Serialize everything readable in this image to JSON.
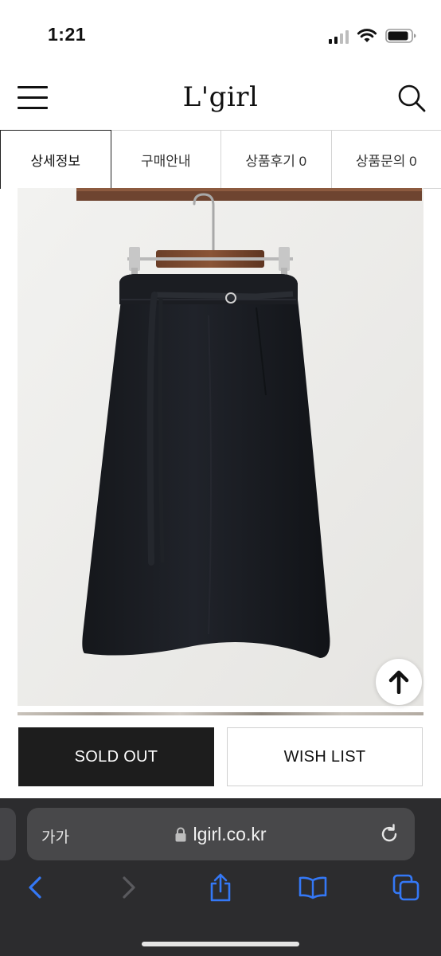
{
  "status_bar": {
    "time": "1:21",
    "icons": [
      "signal-icon",
      "wifi-icon",
      "battery-icon"
    ]
  },
  "header": {
    "logo": "L'girl",
    "menu_icon": "menu-icon",
    "search_icon": "search-icon"
  },
  "tabs": [
    {
      "label": "상세정보",
      "active": true
    },
    {
      "label": "구매안내",
      "active": false
    },
    {
      "label": "상품후기 0",
      "active": false
    },
    {
      "label": "상품문의 0",
      "active": false
    }
  ],
  "product": {
    "image": "black-skirt-on-hanger",
    "scroll_top_icon": "arrow-up-icon"
  },
  "buttons": {
    "sold_out": "SOLD OUT",
    "wish_list": "WISH LIST"
  },
  "browser": {
    "text_size_label": "가가",
    "url": "lgirl.co.kr",
    "secure_icon": "lock-icon",
    "reload_icon": "reload-icon",
    "toolbar": [
      "back-icon",
      "forward-icon",
      "share-icon",
      "bookmarks-icon",
      "tabs-icon"
    ]
  },
  "colors": {
    "accent_dark": "#1d1d1d",
    "browser_bar": "#2c2c2e",
    "ios_blue": "#3478f6"
  }
}
